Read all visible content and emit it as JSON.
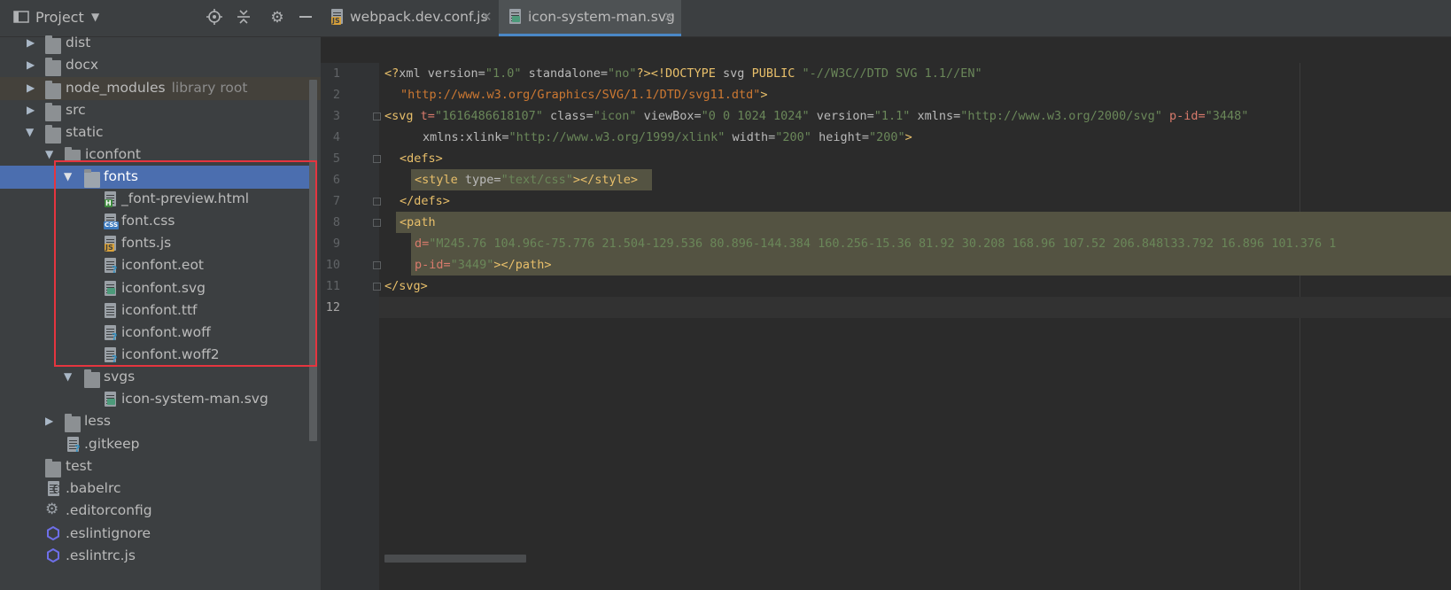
{
  "project_panel": {
    "title": "Project",
    "tree": [
      {
        "label": "dist"
      },
      {
        "label": "docx"
      },
      {
        "label": "node_modules",
        "sublabel": "library root"
      },
      {
        "label": "src"
      },
      {
        "label": "static"
      },
      {
        "label": "iconfont"
      },
      {
        "label": "fonts"
      },
      {
        "label": "_font-preview.html",
        "badge": "H"
      },
      {
        "label": "font.css",
        "badge": "CSS"
      },
      {
        "label": "fonts.js",
        "badge": "JS"
      },
      {
        "label": "iconfont.eot"
      },
      {
        "label": "iconfont.svg"
      },
      {
        "label": "iconfont.ttf"
      },
      {
        "label": "iconfont.woff"
      },
      {
        "label": "iconfont.woff2"
      },
      {
        "label": "svgs"
      },
      {
        "label": "icon-system-man.svg"
      },
      {
        "label": "less"
      },
      {
        "label": ".gitkeep"
      },
      {
        "label": "test"
      },
      {
        "label": ".babelrc"
      },
      {
        "label": ".editorconfig"
      },
      {
        "label": ".eslintignore"
      },
      {
        "label": ".eslintrc.js"
      }
    ]
  },
  "tabs": [
    {
      "label": "webpack.dev.conf.js",
      "badge": "JS"
    },
    {
      "label": "icon-system-man.svg",
      "active": true
    }
  ],
  "editor": {
    "line_numbers": [
      "1",
      "2",
      "3",
      "4",
      "5",
      "6",
      "7",
      "8",
      "9",
      "10",
      "11",
      "12"
    ],
    "code": {
      "l1_a": "<?",
      "l1_b": "xml version=",
      "l1_c": "\"1.0\"",
      "l1_d": " standalone=",
      "l1_e": "\"no\"",
      "l1_f": "?><!DOCTYPE",
      "l1_g": " svg ",
      "l1_h": "PUBLIC",
      "l1_i": " \"-//W3C//DTD SVG 1.1//EN\"",
      "l2_a": "\"http://www.w3.org/Graphics/SVG/1.1/DTD/svg11.dtd\"",
      "l2_b": ">",
      "l3_a": "<svg",
      "l3_b": " t=",
      "l3_c": "\"1616486618107\"",
      "l3_d": " class=",
      "l3_e": "\"icon\"",
      "l3_f": " viewBox=",
      "l3_g": "\"0 0 1024 1024\"",
      "l3_h": " version=",
      "l3_i": "\"1.1\"",
      "l3_j": " xmlns=",
      "l3_k": "\"http://www.w3.org/2000/svg\"",
      "l3_l": " p-id=",
      "l3_m": "\"3448\"",
      "l4_a": "xmlns:xlink=",
      "l4_b": "\"http://www.w3.org/1999/xlink\"",
      "l4_c": " width=",
      "l4_d": "\"200\"",
      "l4_e": " height=",
      "l4_f": "\"200\"",
      "l4_g": ">",
      "l5": "<defs>",
      "l6_a": "<style",
      "l6_b": " type=",
      "l6_c": "\"text/css\"",
      "l6_d": "></style>",
      "l7": "</defs>",
      "l8": "<path",
      "l9_a": "d=",
      "l9_b": "\"M245.76 104.96c-75.776 21.504-129.536 80.896-144.384 160.256-15.36 81.92 30.208 168.96 107.52 206.848l33.792 16.896 101.376 1",
      "l10_a": "p-id=",
      "l10_b": "\"3449\"",
      "l10_c": "></path>",
      "l11": "</svg>"
    }
  },
  "colors": {
    "selection": "#4b6eaf",
    "annotation_box": "#e5353f",
    "tag": "#e8bf6a",
    "string": "#6a8759"
  }
}
